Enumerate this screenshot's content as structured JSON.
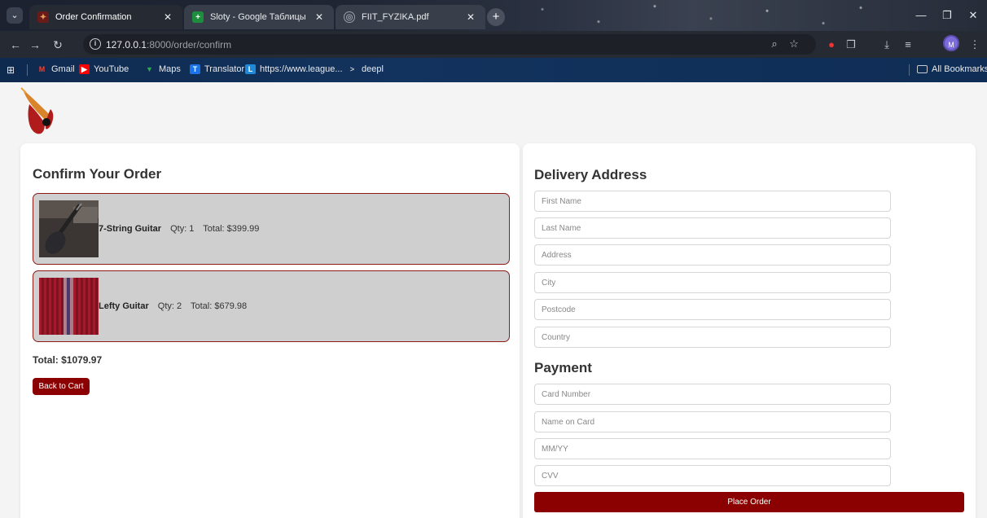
{
  "browser": {
    "tabs": [
      {
        "title": "Order Confirmation",
        "active": true
      },
      {
        "title": "Sloty - Google Таблицы",
        "active": false
      },
      {
        "title": "FIIT_FYZIKA.pdf",
        "active": false
      }
    ],
    "url_host": "127.0.0.1",
    "url_path": ":8000/order/confirm",
    "bookmarks": [
      {
        "label": "Gmail",
        "icon": "gmail-icon"
      },
      {
        "label": "YouTube",
        "icon": "youtube-icon"
      },
      {
        "label": "Maps",
        "icon": "maps-icon"
      },
      {
        "label": "Translator",
        "icon": "translator-icon"
      },
      {
        "label": "https://www.league...",
        "icon": "league-icon"
      },
      {
        "label": "deepl",
        "icon": "deepl-icon"
      }
    ],
    "all_bookmarks": "All Bookmarks",
    "profile_initial": "M"
  },
  "order": {
    "heading": "Confirm Your Order",
    "items": [
      {
        "name": "7-String Guitar",
        "qty": "Qty: 1",
        "total": "Total: $399.99"
      },
      {
        "name": "Lefty Guitar",
        "qty": "Qty: 2",
        "total": "Total: $679.98"
      }
    ],
    "grand_total": "Total: $1079.97",
    "back_button": "Back to Cart"
  },
  "delivery": {
    "heading": "Delivery Address",
    "fields": {
      "first_name": "First Name",
      "last_name": "Last Name",
      "address": "Address",
      "city": "City",
      "postcode": "Postcode",
      "country": "Country"
    }
  },
  "payment": {
    "heading": "Payment",
    "fields": {
      "card_number": "Card Number",
      "name_on_card": "Name on Card",
      "expiry": "MM/YY",
      "cvv": "CVV"
    },
    "submit_button": "Place Order"
  },
  "colors": {
    "accent": "#8b0000",
    "item_border": "#8b1a1a",
    "item_background": "#cfcfcf"
  }
}
